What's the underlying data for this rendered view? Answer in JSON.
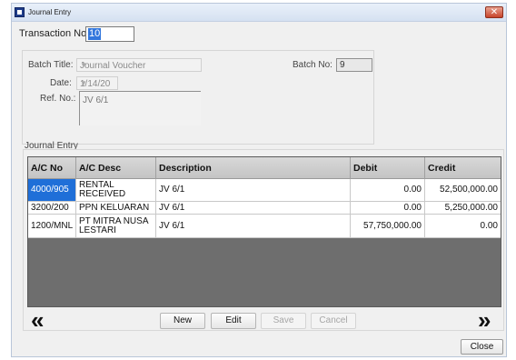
{
  "window": {
    "title": "Journal Entry",
    "close_glyph": "✕"
  },
  "transaction": {
    "label": "Transaction No:",
    "value": "10"
  },
  "batch": {
    "title_label": "Batch Title:",
    "title_value": "Journal Voucher",
    "no_label": "Batch No:",
    "no_value": "9",
    "date_label": "Date:",
    "date_value": "1/14/20",
    "ref_label": "Ref. No.:",
    "ref_value": "JV 6/1"
  },
  "journal": {
    "section_label": "Journal Entry",
    "columns": [
      "A/C No",
      "A/C Desc",
      "Description",
      "Debit",
      "Credit"
    ],
    "rows": [
      {
        "ac_no": "4000/905",
        "ac_desc": "RENTAL RECEIVED",
        "description": "JV 6/1",
        "debit": "0.00",
        "credit": "52,500,000.00"
      },
      {
        "ac_no": "3200/200",
        "ac_desc": "PPN KELUARAN",
        "description": "JV 6/1",
        "debit": "0.00",
        "credit": "5,250,000.00"
      },
      {
        "ac_no": "1200/MNL",
        "ac_desc": "PT MITRA NUSA LESTARI",
        "description": "JV 6/1",
        "debit": "57,750,000.00",
        "credit": "0.00"
      }
    ]
  },
  "nav": {
    "prev": "«",
    "next": "»"
  },
  "buttons": {
    "new": "New",
    "edit": "Edit",
    "save": "Save",
    "cancel": "Cancel",
    "close": "Close"
  },
  "icons": {
    "prev": "double-chevron-left-icon",
    "next": "double-chevron-right-icon",
    "app": "app-icon",
    "dropdown": "chevron-down-icon"
  }
}
